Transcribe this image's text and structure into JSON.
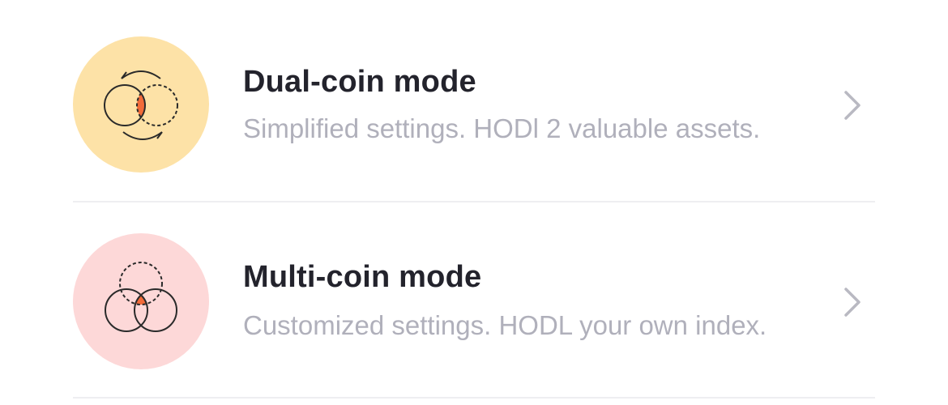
{
  "modes": [
    {
      "title": "Dual-coin mode",
      "subtitle": "Simplified settings. HODl 2 valuable assets.",
      "icon": "dual-coin-icon",
      "icon_bg": "#fde2a7"
    },
    {
      "title": "Multi-coin mode",
      "subtitle": "Customized settings. HODL your own index.",
      "icon": "multi-coin-icon",
      "icon_bg": "#fdd8d8"
    }
  ],
  "colors": {
    "title": "#23232c",
    "subtitle": "#b0b0bb",
    "accent": "#f26b3a",
    "chevron": "#b9b9c2",
    "divider": "#eeeef1"
  },
  "chevron_icon": "chevron-right-icon"
}
